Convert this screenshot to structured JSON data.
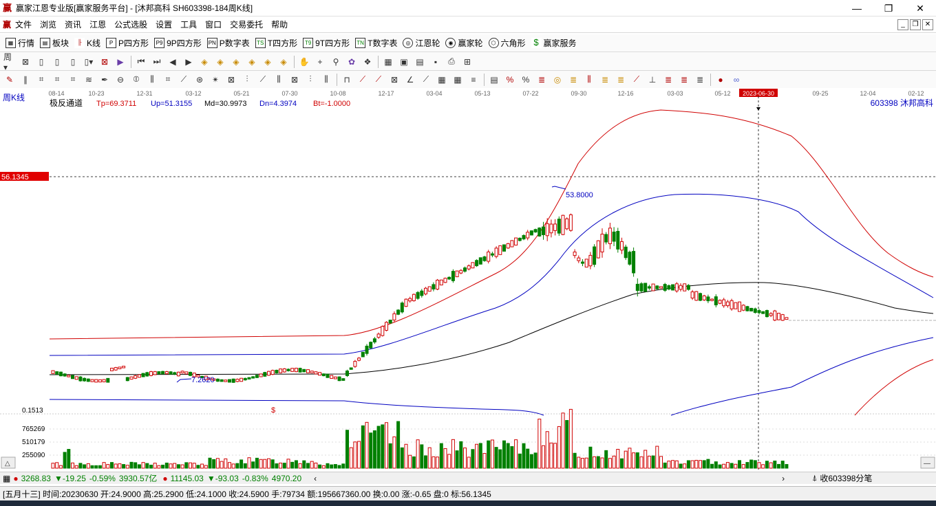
{
  "window": {
    "title": "赢家江恩专业版[赢家服务平台] - [沐邦高科   SH603398-184周K线]",
    "logo": "赢",
    "min": "—",
    "max": "❐",
    "close": "✕"
  },
  "menu": {
    "items": [
      "文件",
      "浏览",
      "资讯",
      "江恩",
      "公式选股",
      "设置",
      "工具",
      "窗口",
      "交易委托",
      "帮助"
    ]
  },
  "toolbar1": {
    "items": [
      {
        "label": "行情",
        "icon": "grid-icon"
      },
      {
        "label": "板块",
        "icon": "block-icon"
      },
      {
        "label": "K线",
        "icon": "kline-icon"
      },
      {
        "label": "P四方形",
        "icon": "P"
      },
      {
        "label": "9P四方形",
        "icon": "P9"
      },
      {
        "label": "P数字表",
        "icon": "PN"
      },
      {
        "label": "T四方形",
        "icon": "TS"
      },
      {
        "label": "9T四方形",
        "icon": "T9"
      },
      {
        "label": "T数字表",
        "icon": "TN"
      },
      {
        "label": "江恩轮",
        "icon": "wheel-icon"
      },
      {
        "label": "赢家轮",
        "icon": "wheel2-icon"
      },
      {
        "label": "六角形",
        "icon": "hexagon-icon"
      },
      {
        "label": "赢家服务",
        "icon": "dollar-icon"
      }
    ]
  },
  "chart": {
    "period_label": "周K线",
    "indicator": {
      "name": "极反通道",
      "tp": "Tp=69.3711",
      "up": "Up=51.3155",
      "md": "Md=30.9973",
      "dn": "Dn=4.3974",
      "bt": "Bt=-1.0000"
    },
    "stock": "603398  沐邦高科",
    "date_axis": [
      "08-14",
      "10-23",
      "12-31",
      "03-12",
      "05-21",
      "07-30",
      "10-08",
      "12-17",
      "03-04",
      "05-13",
      "07-22",
      "09-30",
      "12-16",
      "03-03",
      "05-12",
      "2023-06-30",
      "09-25",
      "12-04",
      "02-12"
    ],
    "price_marker": "56.1345",
    "peak_label": "53.8000",
    "low_label": "7.2620",
    "volume_scale_top": "0.1513",
    "volume_ticks": [
      "765269",
      "510179",
      "255090"
    ],
    "dollar_mark": "$"
  },
  "chart_data": {
    "type": "candlestick",
    "title": "沐邦高科 SH603398 周K线",
    "peak": 53.8,
    "low": 7.262,
    "selected_bar": {
      "date": "20230630",
      "open": 24.9,
      "high": 25.29,
      "low": 24.1,
      "close": 24.59,
      "hand": 79734,
      "amount": 195667360.0
    }
  },
  "status1": {
    "idx1_value": "3268.83",
    "idx1_change": "▼-19.25",
    "idx1_pct": "-0.59%",
    "idx1_amt": "3930.57亿",
    "idx2_value": "11145.03",
    "idx2_change": "▼-93.03",
    "idx2_pct": "-0.83%",
    "idx2_amt": "4970.20",
    "right_text": "收603398分笔"
  },
  "status2": {
    "text": "[五月十三] 时间:20230630 开:24.9000 高:25.2900 低:24.1000 收:24.5900 手:79734 额:195667360.00 换:0.00 涨:-0.65 盘:0 标:56.1345"
  }
}
